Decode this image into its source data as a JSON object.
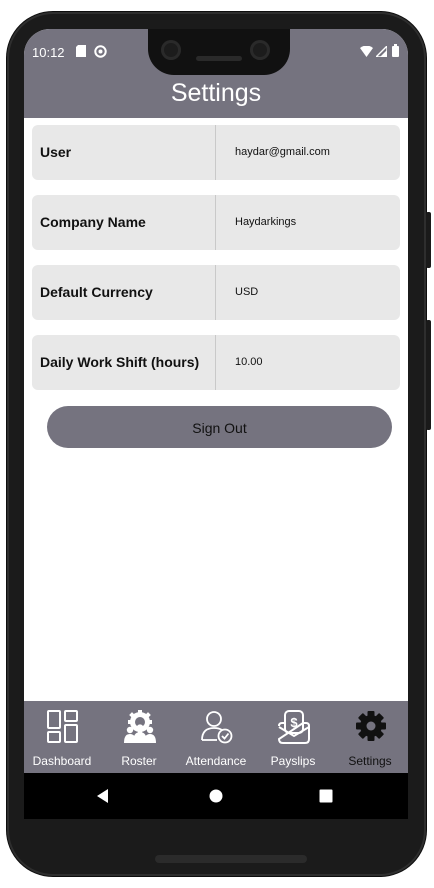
{
  "status_bar": {
    "time": "10:12"
  },
  "header": {
    "title": "Settings"
  },
  "settings_rows": [
    {
      "label": "User",
      "value": "haydar@gmail.com"
    },
    {
      "label": "Company Name",
      "value": "Haydarkings"
    },
    {
      "label": "Default Currency",
      "value": "USD"
    },
    {
      "label": "Daily Work Shift (hours)",
      "value": "10.00"
    }
  ],
  "sign_out_label": "Sign Out",
  "bottom_nav": {
    "active": "Settings",
    "items": [
      {
        "label": "Dashboard",
        "icon": "dashboard-icon"
      },
      {
        "label": "Roster",
        "icon": "roster-icon"
      },
      {
        "label": "Attendance",
        "icon": "attendance-icon"
      },
      {
        "label": "Payslips",
        "icon": "payslips-icon"
      },
      {
        "label": "Settings",
        "icon": "gear-icon"
      }
    ]
  },
  "colors": {
    "header": "#75737f",
    "row_background": "#e8e8e8",
    "bottom_nav": "#75737f"
  }
}
